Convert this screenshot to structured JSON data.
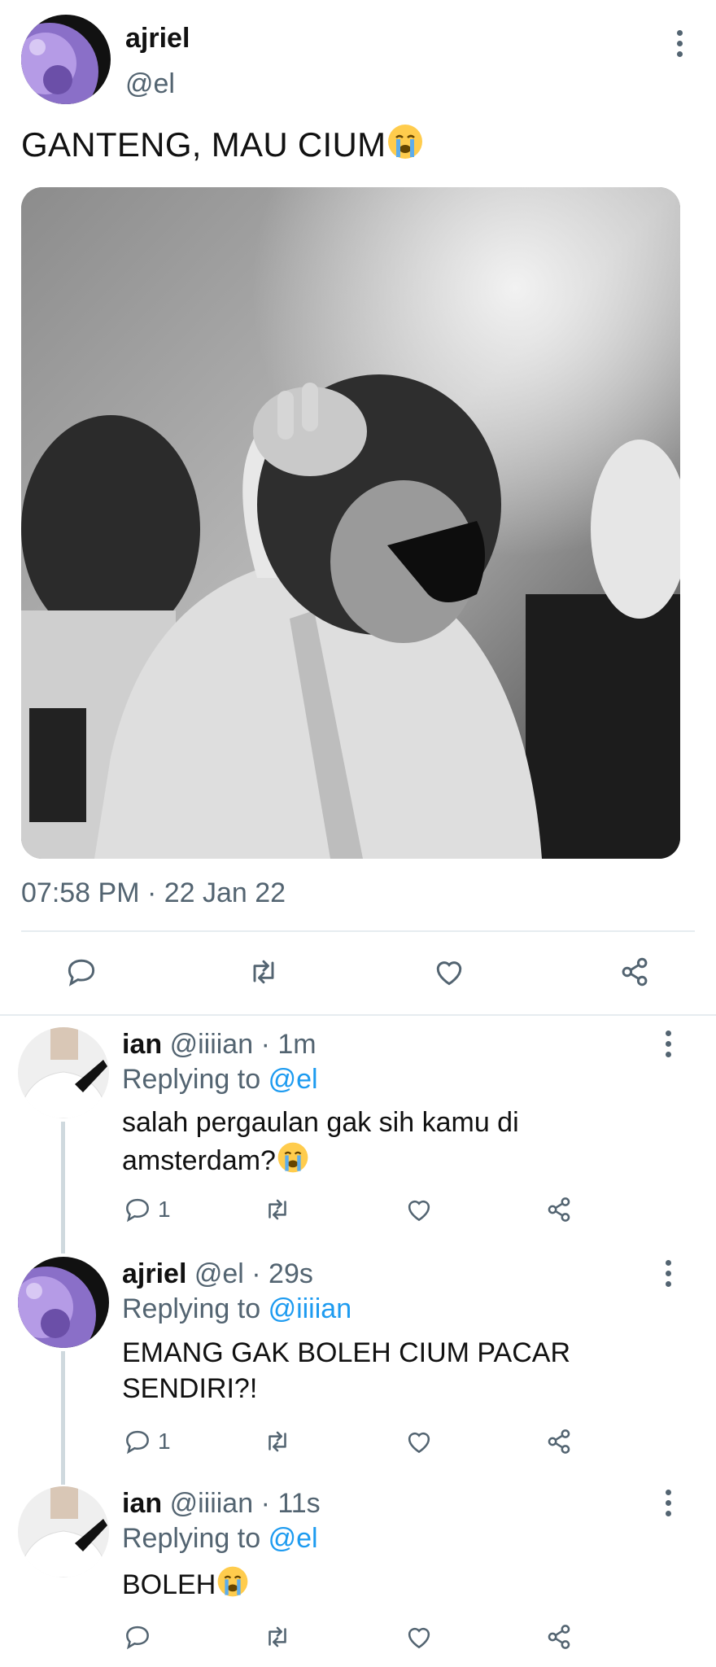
{
  "main_tweet": {
    "name": "ajriel",
    "handle": "@el",
    "text": "GANTENG, MAU CIUM",
    "timestamp": "07:58 PM · 22 Jan 22"
  },
  "replies": [
    {
      "name": "ian",
      "handle": "@iiiian",
      "time": "· 1m",
      "replying_prefix": "Replying to",
      "replying_to": "@el",
      "text_lines": [
        "salah pergaulan gak sih kamu di",
        "amsterdam?"
      ],
      "reply_count": "1"
    },
    {
      "name": "ajriel",
      "handle": "@el",
      "time": "· 29s",
      "replying_prefix": "Replying to",
      "replying_to": "@iiiian",
      "text_lines": [
        "EMANG GAK BOLEH CIUM PACAR",
        "SENDIRI?!"
      ],
      "reply_count": "1"
    },
    {
      "name": "ian",
      "handle": "@iiiian",
      "time": "· 11s",
      "replying_prefix": "Replying to",
      "replying_to": "@el",
      "text_lines": [
        "BOLEH"
      ],
      "reply_count": ""
    }
  ],
  "colors": {
    "secondary_text": "#536471",
    "link": "#1d9bf0",
    "thread_line": "#cfd9de"
  },
  "icons": [
    "more-icon",
    "reply-icon",
    "retweet-icon",
    "like-icon",
    "share-icon",
    "crying-face-emoji"
  ]
}
